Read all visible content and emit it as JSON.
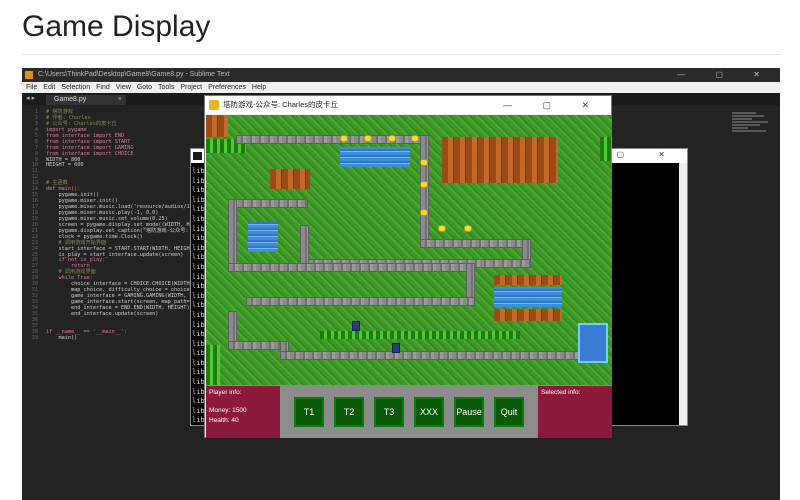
{
  "page": {
    "title": "Game Display"
  },
  "editor": {
    "window_title": "C:\\Users\\ThinkPad\\Desktop\\Game8\\Game8.py - Sublime Text",
    "menu": [
      "File",
      "Edit",
      "Selection",
      "Find",
      "View",
      "Goto",
      "Tools",
      "Project",
      "Preferences",
      "Help"
    ],
    "tab_label": "Game8.py",
    "code_lines": [
      "# 塔防游戏",
      "# 作者: Charles",
      "# 公众号: Charles的皮卡丘",
      "import pygame",
      "from interface import END",
      "from interface import START",
      "from interface import GAMING",
      "from interface import CHOICE",
      "WIDTH = 800",
      "HEIGHT = 600",
      "",
      "",
      "# 主函数",
      "def main():",
      "    pygame.init()",
      "    pygame.mixer.init()",
      "    pygame.mixer.music.load('resource/audios/1.",
      "    pygame.mixer.music.play(-1, 0.0)",
      "    pygame.mixer.music.set_volume(0.25)",
      "    screen = pygame.display.set_mode((WIDTH, HE",
      "    pygame.display.set_caption(\"塔防游戏-公众号:",
      "    clock = pygame.time.Clock()",
      "    # 调用游戏开始界面",
      "    start_interface = START.START(WIDTH, HEIGHT",
      "    is_play = start_interface.update(screen)",
      "    if not is_play:",
      "        return",
      "    # 调用游戏界面",
      "    while True:",
      "        choice_interface = CHOICE.CHOICE(WIDTH,",
      "        map_choice, difficulty_choice = choice_",
      "        game_interface = GAMING.GAMING(WIDTH, H",
      "        game_interface.start(screen, map_path=",
      "        end_interface = END.END(WIDTH, HEIGHT)",
      "        end_interface.update(screen)",
      "",
      "",
      "if __name__ == '__main__':",
      "    main()"
    ]
  },
  "console": {
    "lines": [
      "lib",
      "lib",
      "lib",
      "lib",
      "lib",
      "lib",
      "lib",
      "lib",
      "lib",
      "lib",
      "lib",
      "lib",
      "lib",
      "lib",
      "lib",
      "lib",
      "lib",
      "lib",
      "lib",
      "lib",
      "lib",
      "lib",
      "lib",
      "lib",
      "lib",
      "lib",
      "lib"
    ]
  },
  "game": {
    "window_title": "塔防游戏-公众号: Charles的皮卡丘",
    "hud": {
      "player_info_label": "Player info:",
      "money_label": "Money: 1500",
      "health_label": "Health: 40",
      "selected_info_label": "Selected info:",
      "buttons": [
        "T1",
        "T2",
        "T3",
        "XXX",
        "Pause",
        "Quit"
      ]
    }
  },
  "colors": {
    "grass": "#3f9a26",
    "path": "#8a8a8a",
    "water": "#3c8ddb",
    "dirt": "#c36a27",
    "hud_panel": "#8d1a3a",
    "hud_button": "#0a5a0a",
    "enemy": "#f3d83a"
  }
}
